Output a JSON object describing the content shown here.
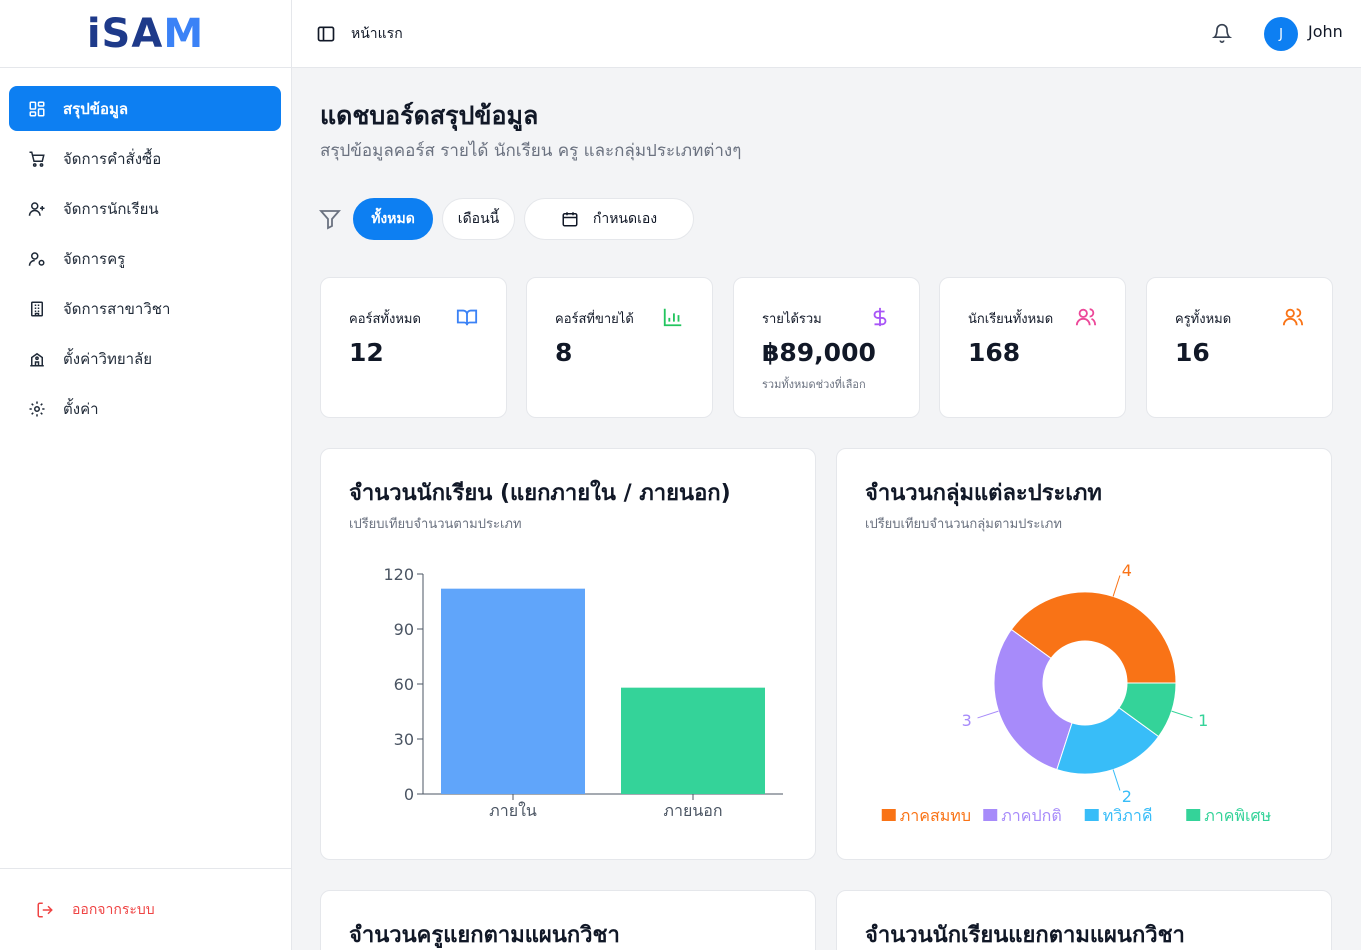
{
  "brand": {
    "logo_main": "iSA",
    "logo_accent": "M"
  },
  "sidebar": {
    "items": [
      {
        "label": "สรุปข้อมูล",
        "icon": "dashboard-grid-icon",
        "active": true
      },
      {
        "label": "จัดการคำสั่งซื้อ",
        "icon": "cart-icon"
      },
      {
        "label": "จัดการนักเรียน",
        "icon": "user-plus-icon"
      },
      {
        "label": "จัดการครู",
        "icon": "user-cog-icon"
      },
      {
        "label": "จัดการสาขาวิชา",
        "icon": "building-icon"
      },
      {
        "label": "ตั้งค่าวิทยาลัย",
        "icon": "school-icon"
      },
      {
        "label": "ตั้งค่า",
        "icon": "gear-icon"
      }
    ],
    "logout_label": "ออกจากระบบ"
  },
  "header": {
    "breadcrumb": "หน้าแรก",
    "user_initial": "J",
    "user_name": "John"
  },
  "page": {
    "title": "แดชบอร์ดสรุปข้อมูล",
    "subtitle": "สรุปข้อมูลคอร์ส รายได้ นักเรียน ครู และกลุ่มประเภทต่างๆ"
  },
  "filters": {
    "all": "ทั้งหมด",
    "this_month": "เดือนนี้",
    "custom": "กำหนดเอง",
    "selected": "all"
  },
  "stats": [
    {
      "label": "คอร์สทั้งหมด",
      "value": "12",
      "note": "",
      "icon": "book-icon",
      "color": "#3b82f6"
    },
    {
      "label": "คอร์สที่ขายได้",
      "value": "8",
      "note": "",
      "icon": "bar-chart-icon",
      "color": "#22c55e"
    },
    {
      "label": "รายได้รวม",
      "value": "฿89,000",
      "note": "รวมทั้งหมดช่วงที่เลือก",
      "icon": "dollar-icon",
      "color": "#a855f7"
    },
    {
      "label": "นักเรียนทั้งหมด",
      "value": "168",
      "note": "",
      "icon": "users-icon",
      "color": "#ec4899"
    },
    {
      "label": "ครูทั้งหมด",
      "value": "16",
      "note": "",
      "icon": "users-icon",
      "color": "#f97316"
    }
  ],
  "cards": {
    "students": {
      "title": "จำนวนนักเรียน (แยกภายใน / ภายนอก)",
      "subtitle": "เปรียบเทียบจำนวนตามประเภท"
    },
    "groups": {
      "title": "จำนวนกลุ่มแต่ละประเภท",
      "subtitle": "เปรียบเทียบจำนวนกลุ่มตามประเภท"
    },
    "teachers_by_dept": {
      "title": "จำนวนครูแยกตามแผนกวิชา"
    },
    "students_by_dept": {
      "title": "จำนวนนักเรียนแยกตามแผนกวิชา"
    }
  },
  "chart_data": [
    {
      "type": "bar",
      "categories": [
        "ภายใน",
        "ภายนอก"
      ],
      "values": [
        112,
        58
      ],
      "colors": [
        "#60a5fa",
        "#34d399"
      ],
      "ylim": [
        0,
        120
      ],
      "yticks": [
        0,
        30,
        60,
        90,
        120
      ],
      "grid": false
    },
    {
      "type": "pie",
      "donut": true,
      "categories": [
        "ภาคสมทบ",
        "ภาคปกติ",
        "ทวิภาคี",
        "ภาคพิเศษ"
      ],
      "values": [
        4,
        3,
        2,
        1
      ],
      "colors": [
        "#f97316",
        "#a78bfa",
        "#38bdf8",
        "#34d399"
      ],
      "legend": "bottom"
    }
  ]
}
